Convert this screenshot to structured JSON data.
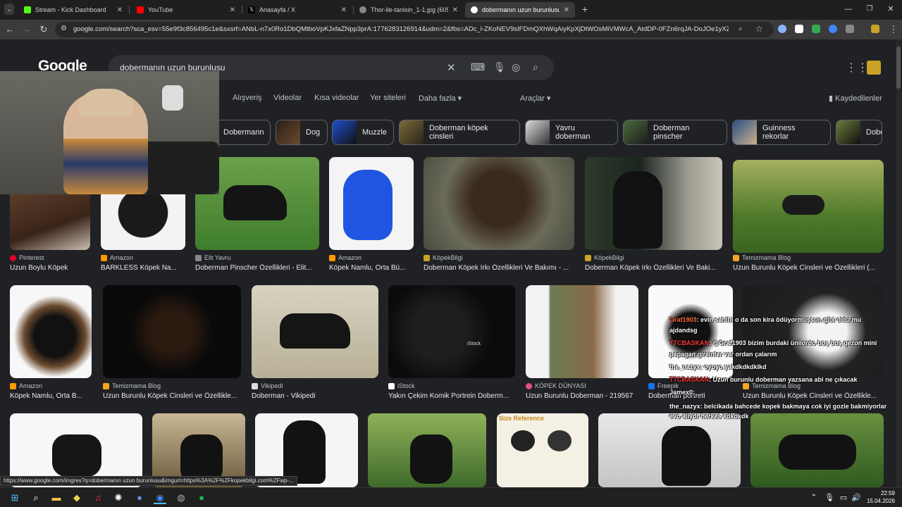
{
  "tabs": [
    {
      "label": "Stream - Kick Dashboard",
      "color": "#53fc18"
    },
    {
      "label": "YouTube",
      "color": "#ff0000"
    },
    {
      "label": "Anasayfa / X",
      "color": "#000000"
    },
    {
      "label": "Thor-ile-tanisin_1-1.jpg (605×6",
      "color": "#888888"
    },
    {
      "label": "dobermanın uzun burunlusu - G",
      "color": "#4285f4"
    }
  ],
  "address": {
    "url": "google.com/search?sca_esv=55e9f3c856495c1e&sxsrf=ANbL-n7x0Ro1DbQMtboVpKJxfaZNpp3prA:1776283126914&udm=2&fbs=ADc_l-ZKoNEV9sIFDmQXhWqAiyKpXjDtWOsMiVMWcA_AtdDP-0FZn6rqJA-DoJOe1yXZR0a6R..."
  },
  "search": {
    "logo": "Google",
    "query": "dobermanın uzun burunlusu"
  },
  "filters": [
    "Alışveriş",
    "Videolar",
    "Kısa videolar",
    "Yer siteleri",
    "Daha fazla"
  ],
  "tools_label": "Araçlar",
  "saved_label": "Kaydedilenler",
  "chips": [
    "Dobermann",
    "Dog",
    "Muzzle",
    "Doberman köpek cinsleri",
    "Yavru doberman",
    "Doberman pinscher",
    "Guinness rekorlar",
    "Dobe"
  ],
  "results_row1": [
    {
      "source": "Pinterest",
      "title": "Uzun Boylu Köpek",
      "src_color": "#e60023"
    },
    {
      "source": "Amazon",
      "title": "BARKLESS Köpek Na...",
      "src_color": "#ff9900"
    },
    {
      "source": "Elit Yavru",
      "title": "Doberman Pinscher Özellikleri - Elit...",
      "src_color": "#888888"
    },
    {
      "source": "Amazon",
      "title": "Köpek Namlu, Orta Bü...",
      "src_color": "#ff9900"
    },
    {
      "source": "KöpekBilgi",
      "title": "Doberman Köpek Irkı Özellikleri Ve Bakımı - ...",
      "src_color": "#c9a227"
    },
    {
      "source": "KöpekBilgi",
      "title": "Doberman Köpek Irkı Özellikleri Ve Baki...",
      "src_color": "#c9a227"
    },
    {
      "source": "Temizmama Blog",
      "title": "Uzun Burunlu Köpek Cinsleri ve Özellikleri (...",
      "src_color": "#f5a623"
    }
  ],
  "results_row2": [
    {
      "source": "Amazon",
      "title": "Köpek Namlu, Orta B...",
      "src_color": "#ff9900"
    },
    {
      "source": "Temizmama Blog",
      "title": "Uzun Burunlu Köpek Cinsleri ve Özellikle...",
      "src_color": "#f5a623"
    },
    {
      "source": "Vikipedi",
      "title": "Doberman - Vikipedi",
      "src_color": "#dddddd"
    },
    {
      "source": "iStock",
      "title": "Yakın Çekim Komik Portrein Doberm...",
      "src_color": "#ffffff"
    },
    {
      "source": "KÖPEK DÜNYASI",
      "title": "Uzun Burunlu Doberman - 219567",
      "src_color": "#e04e8a"
    },
    {
      "source": "Freepik",
      "title": "Doberman portreti",
      "src_color": "#1273eb"
    },
    {
      "source": "Temizmama Blog",
      "title": "Uzun Burunlu Köpek Cinsleri ve Özellikle...",
      "src_color": "#f5a623"
    }
  ],
  "size_reference_label": "Size Reference",
  "istock_watermark": "iStock",
  "chat": [
    {
      "user": "Graf1903",
      "text": ": evin sahibi o da son kira ödüyormuşsun gibi oldu mu",
      "color": "#ff6a3d"
    },
    {
      "user": "",
      "text": "ajdandsg",
      "color": "#ffffff"
    },
    {
      "user": "TTCBASKAN",
      "text": ": @Graf1903 bizim burdaki ünilordo boş boş gezon mini",
      "color": "#ff3b3b"
    },
    {
      "user": "",
      "text": "papagan girsinler var ordan çalarım",
      "color": "#ffffff"
    },
    {
      "user": "the_nazyx",
      "text": ": oyuyo yakdkdkdklkd",
      "color": "#ffffff"
    },
    {
      "user": "TTCBASKAN",
      "text": ": Uzun burunlu doberman yazsana abi ne çıkacak",
      "color": "#ff3b3b"
    },
    {
      "user": "Jamex0",
      "text": ":",
      "color": "#ffffff"
    },
    {
      "user": "the_nazyx",
      "text": ": belcikada bahcede kopek bakmaya cok iyi gozle bakmiyorlar",
      "color": "#ffffff"
    },
    {
      "user": "",
      "text": "evo aliyor herkes kdkdkdk",
      "color": "#ffffff"
    }
  ],
  "status_url": "https://www.google.com/imgres?q=dobermanın uzun burunlusu&imgurl=https%3A%2F%2Fkopekbilgi.com%2Fwp-...",
  "clock": {
    "time": "22:59",
    "date": "15.04.2026"
  }
}
